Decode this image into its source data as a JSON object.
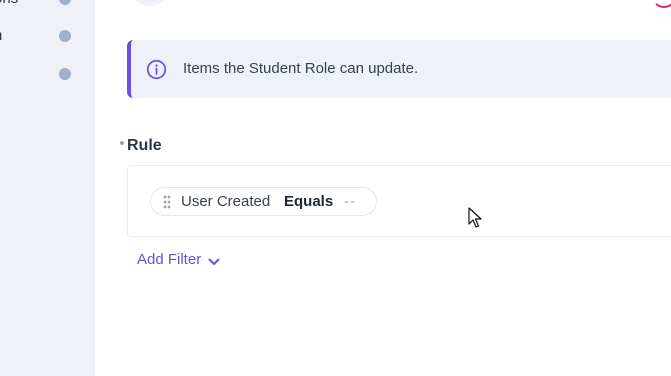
{
  "sidebar": {
    "items": [
      {
        "label": "ons",
        "indicator": "dot"
      },
      {
        "label": "n",
        "indicator": "dot"
      },
      {
        "label": "",
        "indicator": "dot"
      }
    ]
  },
  "info_banner": {
    "icon": "info-icon",
    "text": "Items the Student Role can update."
  },
  "rule": {
    "label": "Rule",
    "required_marker": "•",
    "filters": [
      {
        "field": "User Created",
        "operator": "Equals",
        "value": "--",
        "handle_icon": "drag-handle-icon"
      }
    ]
  },
  "add_filter": {
    "label": "Add Filter",
    "icon": "chevron-down-icon"
  },
  "colors": {
    "accent": "#6d4fe0",
    "sidebar_bg": "#eef1f6",
    "sidebar_dot": "#9fb0cc",
    "banner_bg": "#eef1f7"
  }
}
